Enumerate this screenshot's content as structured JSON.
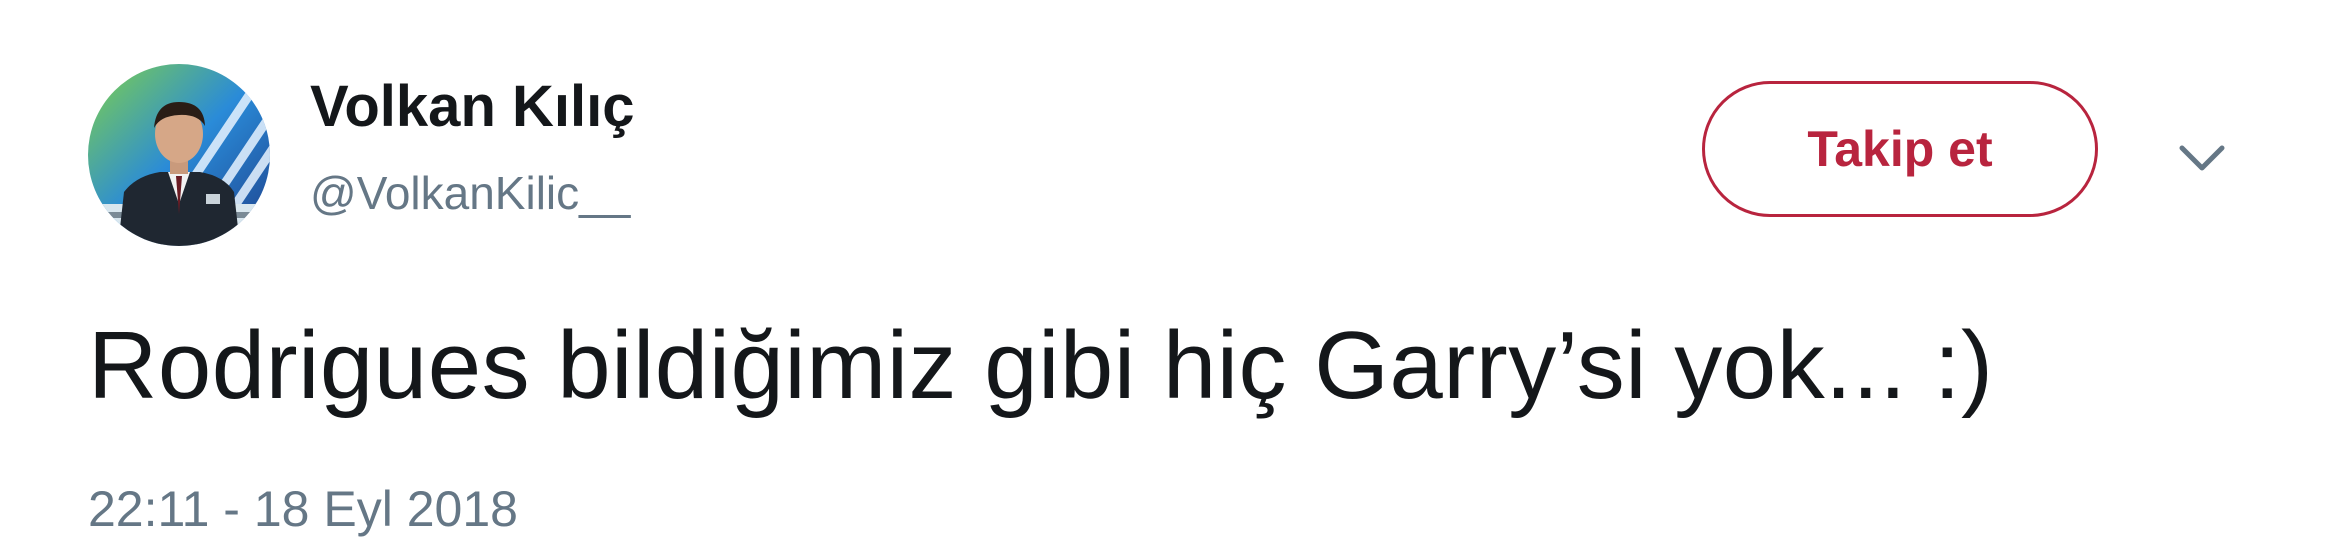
{
  "tweet": {
    "author": {
      "name": "Volkan Kılıç",
      "handle": "@VolkanKilic__"
    },
    "follow_label": "Takip et",
    "menu_icon": "chevron-down-icon",
    "text": "Rodrigues bildiğimiz gibi hiç Garry’si yok... :)",
    "timestamp": "22:11 - 18 Eyl 2018"
  },
  "colors": {
    "follow_accent": "#b8243e",
    "name_text": "#14171a",
    "secondary_text": "#657786"
  }
}
